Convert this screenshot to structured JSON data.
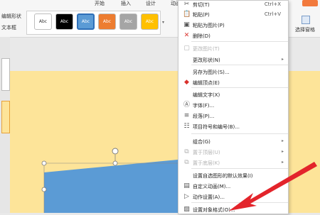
{
  "ribbon": {
    "tabs": [
      "开始",
      "插入",
      "设计",
      "动画"
    ],
    "left_labels": [
      "编辑形状",
      "文本框"
    ],
    "right_labels": [
      "选择窗格"
    ],
    "swatches": [
      {
        "text": "Abc",
        "bg": "#ffffff",
        "fg": "#333333"
      },
      {
        "text": "Abc",
        "bg": "#000000",
        "fg": "#ffffff"
      },
      {
        "text": "Abc",
        "bg": "#5b9bd5",
        "fg": "#ffffff"
      },
      {
        "text": "Abc",
        "bg": "#ed7d31",
        "fg": "#ffffff"
      },
      {
        "text": "Abc",
        "bg": "#a5a5a5",
        "fg": "#ffffff"
      },
      {
        "text": "Abc",
        "bg": "#ffc000",
        "fg": "#ffffff"
      }
    ]
  },
  "menu": {
    "items": [
      {
        "label": "剪切(T)",
        "shortcut": "Ctrl+X",
        "icon": "scissors-icon",
        "glyph": "✂",
        "disabled": false
      },
      {
        "label": "粘贴(P)",
        "shortcut": "Ctrl+V",
        "icon": "paste-icon",
        "glyph": "📋",
        "disabled": false
      },
      {
        "label": "粘贴为图片(P)",
        "shortcut": "",
        "icon": "paste-image-icon",
        "glyph": "▣",
        "disabled": false
      },
      {
        "label": "删除(D)",
        "shortcut": "",
        "icon": "delete-icon",
        "glyph": "✕",
        "disabled": false
      },
      {
        "label": "更改图片(T)",
        "shortcut": "",
        "icon": "change-picture-icon",
        "glyph": "▢",
        "disabled": true
      },
      {
        "label": "更改形状(N)",
        "shortcut": "",
        "icon": "",
        "glyph": "",
        "disabled": false,
        "submenu": true
      },
      {
        "label": "另存为图片(S)...",
        "shortcut": "",
        "icon": "",
        "glyph": "",
        "disabled": false
      },
      {
        "label": "编辑顶点(E)",
        "shortcut": "",
        "icon": "edit-points-icon",
        "glyph": "◆",
        "disabled": false
      },
      {
        "label": "编辑文字(X)",
        "shortcut": "",
        "icon": "",
        "glyph": "",
        "disabled": false
      },
      {
        "label": "字体(F)...",
        "shortcut": "",
        "icon": "font-icon",
        "glyph": "Ⓐ",
        "disabled": false
      },
      {
        "label": "段落(P)...",
        "shortcut": "",
        "icon": "paragraph-icon",
        "glyph": "≡",
        "disabled": false
      },
      {
        "label": "项目符号和编号(B)...",
        "shortcut": "",
        "icon": "bullets-icon",
        "glyph": "☷",
        "disabled": false
      },
      {
        "label": "组合(G)",
        "shortcut": "",
        "icon": "",
        "glyph": "",
        "disabled": false,
        "submenu": true
      },
      {
        "label": "置于顶层(U)",
        "shortcut": "",
        "icon": "bring-front-icon",
        "glyph": "⧉",
        "disabled": true,
        "submenu": true
      },
      {
        "label": "置于底层(K)",
        "shortcut": "",
        "icon": "send-back-icon",
        "glyph": "⧉",
        "disabled": true,
        "submenu": true
      },
      {
        "label": "设置自选图形的默认效果(I)",
        "shortcut": "",
        "icon": "",
        "glyph": "",
        "disabled": false
      },
      {
        "label": "自定义动画(M)...",
        "shortcut": "",
        "icon": "animation-icon",
        "glyph": "▤",
        "disabled": false
      },
      {
        "label": "动作设置(A)...",
        "shortcut": "",
        "icon": "action-icon",
        "glyph": "▷",
        "disabled": false
      },
      {
        "label": "设置对象格式(O)...",
        "shortcut": "",
        "icon": "format-object-icon",
        "glyph": "▨",
        "disabled": false
      }
    ]
  },
  "colors": {
    "slide": "#fde499",
    "shape": "#5b9bd5",
    "arrow": "#e3242b",
    "menu_border": "#c9c9c9"
  }
}
